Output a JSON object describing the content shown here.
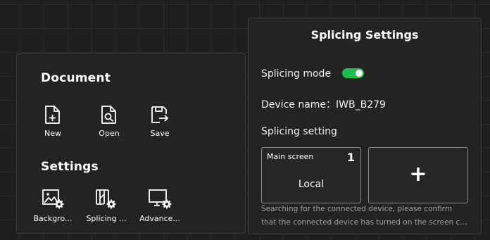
{
  "document": {
    "title": "Document",
    "tools": [
      {
        "label": "New",
        "icon": "new-file-icon"
      },
      {
        "label": "Open",
        "icon": "open-file-icon"
      },
      {
        "label": "Save",
        "icon": "save-icon"
      }
    ]
  },
  "settings": {
    "title": "Settings",
    "tools": [
      {
        "label": "Backgro...",
        "icon": "background-settings-icon"
      },
      {
        "label": "Splicing ...",
        "icon": "splicing-settings-icon"
      },
      {
        "label": "Advance...",
        "icon": "advanced-settings-icon"
      }
    ]
  },
  "splicing": {
    "title": "Splicing Settings",
    "mode_label": "Splicing mode",
    "mode_enabled": true,
    "device_name_label": "Device name：",
    "device_name": "IWB_B279",
    "setting_label": "Splicing setting",
    "main_screen": {
      "label": "Main screen",
      "number": "1",
      "name": "Local"
    },
    "add_label": "+",
    "status_line1": "Searching for the connected device, please confirm",
    "status_line2": "that the connected device has turned on the screen c..."
  },
  "colors": {
    "background": "#1e1e1e",
    "panel": "#232323",
    "toggle_on": "#1fbf4f",
    "status_text": "#a0a0a0"
  }
}
